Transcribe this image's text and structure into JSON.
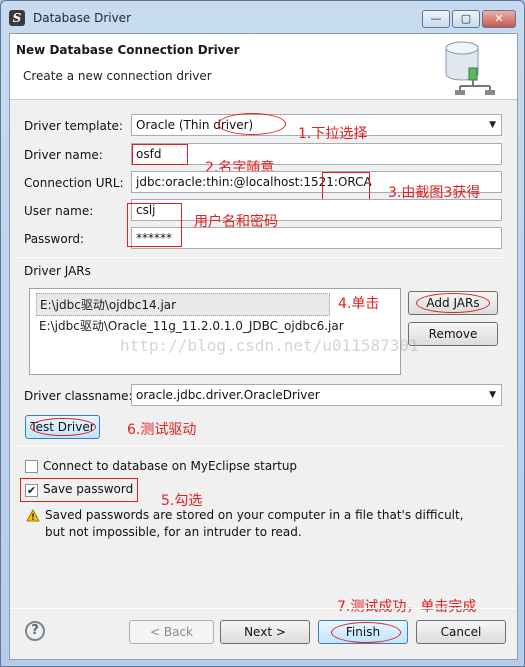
{
  "window": {
    "title": "Database Driver",
    "minimize_icon": "minimize-icon",
    "maximize_icon": "maximize-icon",
    "close_icon": "close-icon"
  },
  "header": {
    "title": "New Database Connection Driver",
    "subtitle": "Create a new connection driver",
    "icon": "database-driver-icon"
  },
  "form": {
    "driver_template": {
      "label": "Driver template:",
      "value": "Oracle (Thin driver)"
    },
    "driver_name": {
      "label": "Driver name:",
      "value": "osfd"
    },
    "connection_url": {
      "label": "Connection URL:",
      "value": "jdbc:oracle:thin:@localhost:1521:ORCA"
    },
    "user_name": {
      "label": "User name:",
      "value": "cslj"
    },
    "password": {
      "label": "Password:",
      "value": "******"
    }
  },
  "driver_jars": {
    "label": "Driver JARs",
    "items": [
      "E:\\jdbc驱动\\ojdbc14.jar",
      "E:\\jdbc驱动\\Oracle_11g_11.2.0.1.0_JDBC_ojdbc6.jar"
    ],
    "add_label": "Add JARs",
    "remove_label": "Remove"
  },
  "driver_classname": {
    "label": "Driver classname:",
    "value": "oracle.jdbc.driver.OracleDriver"
  },
  "test_driver_label": "Test Driver",
  "options": {
    "connect_on_startup": {
      "label": "Connect to database on MyEclipse startup",
      "checked": false
    },
    "save_password": {
      "label": "Save password",
      "checked": true
    }
  },
  "warning": {
    "icon": "warning-icon",
    "text": "Saved passwords are stored on your computer in a file that's difficult, but not impossible, for an intruder to read."
  },
  "footer": {
    "help_icon": "help-icon",
    "back_label": "< Back",
    "next_label": "Next >",
    "finish_label": "Finish",
    "cancel_label": "Cancel"
  },
  "annotations": {
    "a1": "1.下拉选择",
    "a2": "2.名字随意",
    "a3": "3.由截图3获得",
    "a_user": "用户名和密码",
    "a4": "4.单击",
    "a6": "6.测试驱动",
    "a5": "5.勾选",
    "a7": "7.测试成功，单击完成",
    "color": "#e02020"
  },
  "watermark": "http://blog.csdn.net/u011587301"
}
